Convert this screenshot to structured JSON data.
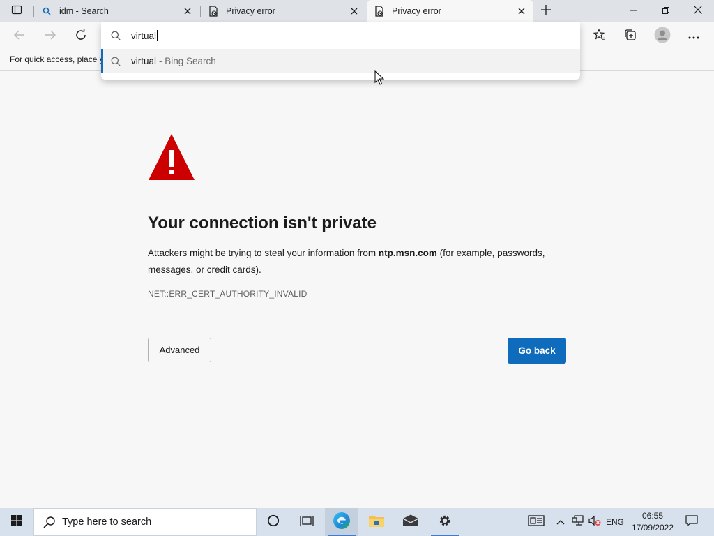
{
  "browser": {
    "tabs": [
      {
        "title": "idm - Search",
        "active": false
      },
      {
        "title": "Privacy error",
        "active": false
      },
      {
        "title": "Privacy error",
        "active": true
      }
    ],
    "favorites_bar_text": "For quick access, place y"
  },
  "omnibox": {
    "typed_text": "virtual",
    "suggestion": {
      "query": "virtual",
      "source": "- Bing Search"
    }
  },
  "error_page": {
    "title": "Your connection isn't private",
    "description_before": "Attackers might be trying to steal your information from ",
    "domain": "ntp.msn.com",
    "description_after": " (for example, passwords, messages, or credit cards).",
    "error_code": "NET::ERR_CERT_AUTHORITY_INVALID",
    "advanced_label": "Advanced",
    "go_back_label": "Go back"
  },
  "taskbar": {
    "search_placeholder": "Type here to search",
    "language": "ENG",
    "time": "06:55",
    "date": "17/09/2022"
  },
  "colors": {
    "accent": "#0f6cbd",
    "warning": "#cc0000",
    "tabstrip": "#dfe3e8",
    "taskbar": "#d7e1ed"
  }
}
